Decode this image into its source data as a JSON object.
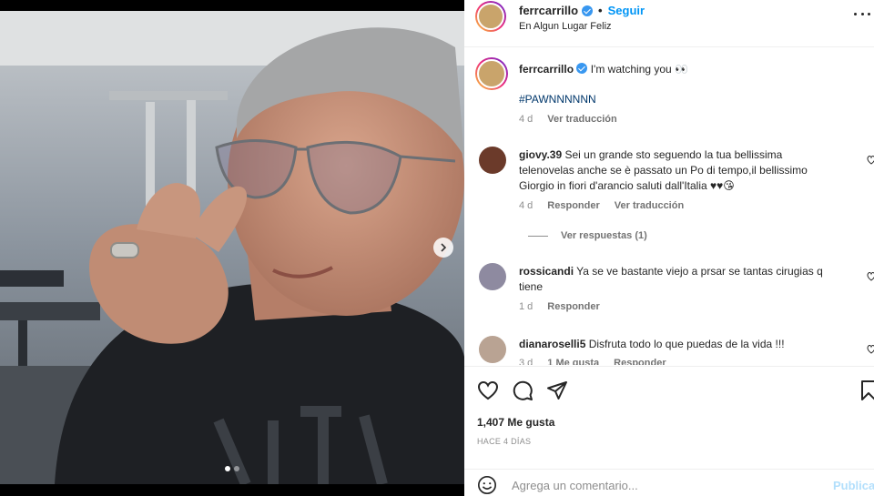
{
  "post": {
    "username": "ferrcarrillo",
    "separator": "•",
    "follow_label": "Seguir",
    "location": "En Algun Lugar Feliz"
  },
  "caption": {
    "username": "ferrcarrillo",
    "text": "I'm watching you 👀",
    "hashtag": "#PAWNNNNNN",
    "time": "4 d",
    "translate": "Ver traducción"
  },
  "comments": [
    {
      "username": "giovy.39",
      "text": "Sei un grande sto seguendo la tua bellissima telenovelas anche se è passato un Po di tempo,il bellissimo Giorgio in fiori d'arancio saluti dall'Italia ♥♥😘",
      "time": "4 d",
      "reply": "Responder",
      "translate": "Ver traducción",
      "view_replies": "Ver respuestas (1)"
    },
    {
      "username": "rossicandi",
      "text": "Ya se ve bastante viejo a prsar se tantas cirugias q tiene",
      "time": "1 d",
      "reply": "Responder"
    },
    {
      "username": "dianaroselli5",
      "text": "Disfruta todo lo que puedas de la vida !!!",
      "time": "3 d",
      "likes": "1 Me gusta",
      "reply": "Responder"
    }
  ],
  "stats": {
    "likes": "1,407 Me gusta",
    "ago": "HACE 4 DÍAS"
  },
  "comment_box": {
    "placeholder": "Agrega un comentario...",
    "publish": "Publicar"
  },
  "icons": {
    "verified": "verified-badge-icon",
    "like": "heart-icon",
    "comment": "comment-icon",
    "share": "paper-plane-icon",
    "save": "bookmark-icon",
    "emoji": "smiley-icon",
    "more": "more-options-icon",
    "next": "chevron-right-icon"
  },
  "colors": {
    "accent": "#0095f6",
    "hashtag": "#00376b",
    "muted": "#8e8e8e",
    "publish_disabled": "#b2dffc"
  },
  "carousel": {
    "slides": 2,
    "active": 1
  }
}
